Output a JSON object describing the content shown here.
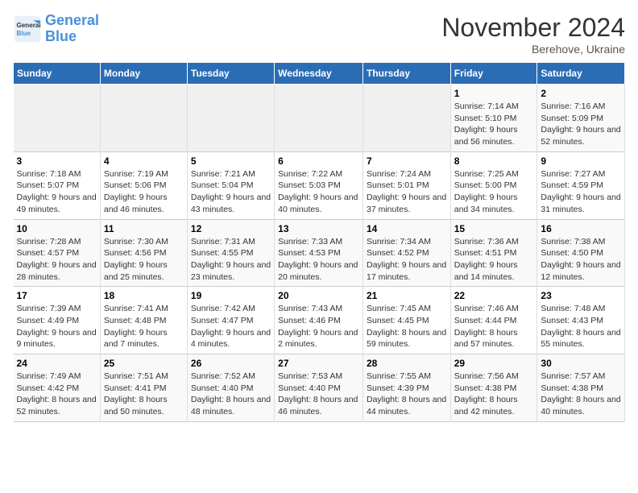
{
  "logo": {
    "line1": "General",
    "line2": "Blue"
  },
  "title": "November 2024",
  "subtitle": "Berehove, Ukraine",
  "weekdays": [
    "Sunday",
    "Monday",
    "Tuesday",
    "Wednesday",
    "Thursday",
    "Friday",
    "Saturday"
  ],
  "weeks": [
    [
      {
        "day": "",
        "info": ""
      },
      {
        "day": "",
        "info": ""
      },
      {
        "day": "",
        "info": ""
      },
      {
        "day": "",
        "info": ""
      },
      {
        "day": "",
        "info": ""
      },
      {
        "day": "1",
        "info": "Sunrise: 7:14 AM\nSunset: 5:10 PM\nDaylight: 9 hours and 56 minutes."
      },
      {
        "day": "2",
        "info": "Sunrise: 7:16 AM\nSunset: 5:09 PM\nDaylight: 9 hours and 52 minutes."
      }
    ],
    [
      {
        "day": "3",
        "info": "Sunrise: 7:18 AM\nSunset: 5:07 PM\nDaylight: 9 hours and 49 minutes."
      },
      {
        "day": "4",
        "info": "Sunrise: 7:19 AM\nSunset: 5:06 PM\nDaylight: 9 hours and 46 minutes."
      },
      {
        "day": "5",
        "info": "Sunrise: 7:21 AM\nSunset: 5:04 PM\nDaylight: 9 hours and 43 minutes."
      },
      {
        "day": "6",
        "info": "Sunrise: 7:22 AM\nSunset: 5:03 PM\nDaylight: 9 hours and 40 minutes."
      },
      {
        "day": "7",
        "info": "Sunrise: 7:24 AM\nSunset: 5:01 PM\nDaylight: 9 hours and 37 minutes."
      },
      {
        "day": "8",
        "info": "Sunrise: 7:25 AM\nSunset: 5:00 PM\nDaylight: 9 hours and 34 minutes."
      },
      {
        "day": "9",
        "info": "Sunrise: 7:27 AM\nSunset: 4:59 PM\nDaylight: 9 hours and 31 minutes."
      }
    ],
    [
      {
        "day": "10",
        "info": "Sunrise: 7:28 AM\nSunset: 4:57 PM\nDaylight: 9 hours and 28 minutes."
      },
      {
        "day": "11",
        "info": "Sunrise: 7:30 AM\nSunset: 4:56 PM\nDaylight: 9 hours and 25 minutes."
      },
      {
        "day": "12",
        "info": "Sunrise: 7:31 AM\nSunset: 4:55 PM\nDaylight: 9 hours and 23 minutes."
      },
      {
        "day": "13",
        "info": "Sunrise: 7:33 AM\nSunset: 4:53 PM\nDaylight: 9 hours and 20 minutes."
      },
      {
        "day": "14",
        "info": "Sunrise: 7:34 AM\nSunset: 4:52 PM\nDaylight: 9 hours and 17 minutes."
      },
      {
        "day": "15",
        "info": "Sunrise: 7:36 AM\nSunset: 4:51 PM\nDaylight: 9 hours and 14 minutes."
      },
      {
        "day": "16",
        "info": "Sunrise: 7:38 AM\nSunset: 4:50 PM\nDaylight: 9 hours and 12 minutes."
      }
    ],
    [
      {
        "day": "17",
        "info": "Sunrise: 7:39 AM\nSunset: 4:49 PM\nDaylight: 9 hours and 9 minutes."
      },
      {
        "day": "18",
        "info": "Sunrise: 7:41 AM\nSunset: 4:48 PM\nDaylight: 9 hours and 7 minutes."
      },
      {
        "day": "19",
        "info": "Sunrise: 7:42 AM\nSunset: 4:47 PM\nDaylight: 9 hours and 4 minutes."
      },
      {
        "day": "20",
        "info": "Sunrise: 7:43 AM\nSunset: 4:46 PM\nDaylight: 9 hours and 2 minutes."
      },
      {
        "day": "21",
        "info": "Sunrise: 7:45 AM\nSunset: 4:45 PM\nDaylight: 8 hours and 59 minutes."
      },
      {
        "day": "22",
        "info": "Sunrise: 7:46 AM\nSunset: 4:44 PM\nDaylight: 8 hours and 57 minutes."
      },
      {
        "day": "23",
        "info": "Sunrise: 7:48 AM\nSunset: 4:43 PM\nDaylight: 8 hours and 55 minutes."
      }
    ],
    [
      {
        "day": "24",
        "info": "Sunrise: 7:49 AM\nSunset: 4:42 PM\nDaylight: 8 hours and 52 minutes."
      },
      {
        "day": "25",
        "info": "Sunrise: 7:51 AM\nSunset: 4:41 PM\nDaylight: 8 hours and 50 minutes."
      },
      {
        "day": "26",
        "info": "Sunrise: 7:52 AM\nSunset: 4:40 PM\nDaylight: 8 hours and 48 minutes."
      },
      {
        "day": "27",
        "info": "Sunrise: 7:53 AM\nSunset: 4:40 PM\nDaylight: 8 hours and 46 minutes."
      },
      {
        "day": "28",
        "info": "Sunrise: 7:55 AM\nSunset: 4:39 PM\nDaylight: 8 hours and 44 minutes."
      },
      {
        "day": "29",
        "info": "Sunrise: 7:56 AM\nSunset: 4:38 PM\nDaylight: 8 hours and 42 minutes."
      },
      {
        "day": "30",
        "info": "Sunrise: 7:57 AM\nSunset: 4:38 PM\nDaylight: 8 hours and 40 minutes."
      }
    ]
  ]
}
